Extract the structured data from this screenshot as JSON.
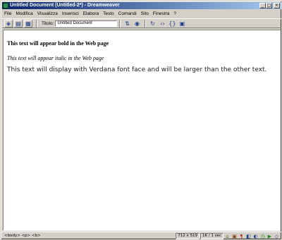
{
  "window": {
    "title": "Untitled Document (Untitled-2*) - Dreamweaver",
    "buttons": {
      "minimize": "_",
      "maximize": "□",
      "close": "×"
    }
  },
  "menu": [
    "File",
    "Modifica",
    "Visualizza",
    "Inserisci",
    "Elabora",
    "Testo",
    "Comandi",
    "Sito",
    "Finestra",
    "?"
  ],
  "toolbar": {
    "title_label": "Titolo:",
    "title_value": "Untitled Document",
    "icons": [
      "code-view-icon",
      "split-view-icon",
      "design-view-icon",
      "file-management-icon",
      "preview-browser-icon",
      "refresh-icon",
      "code-nav-icon",
      "view-options-icon",
      "page-properties-icon"
    ]
  },
  "document": {
    "line_bold": "This text will appear bold in the Web page",
    "line_italic": "This text will appear italic in the Web page",
    "line_verdana": "This text will display with Verdana font face and will be larger than the other text."
  },
  "status": {
    "tag_selector": "<body> <p> <b>",
    "window_size": "712 x 519",
    "download": "1K / 1 sec"
  }
}
